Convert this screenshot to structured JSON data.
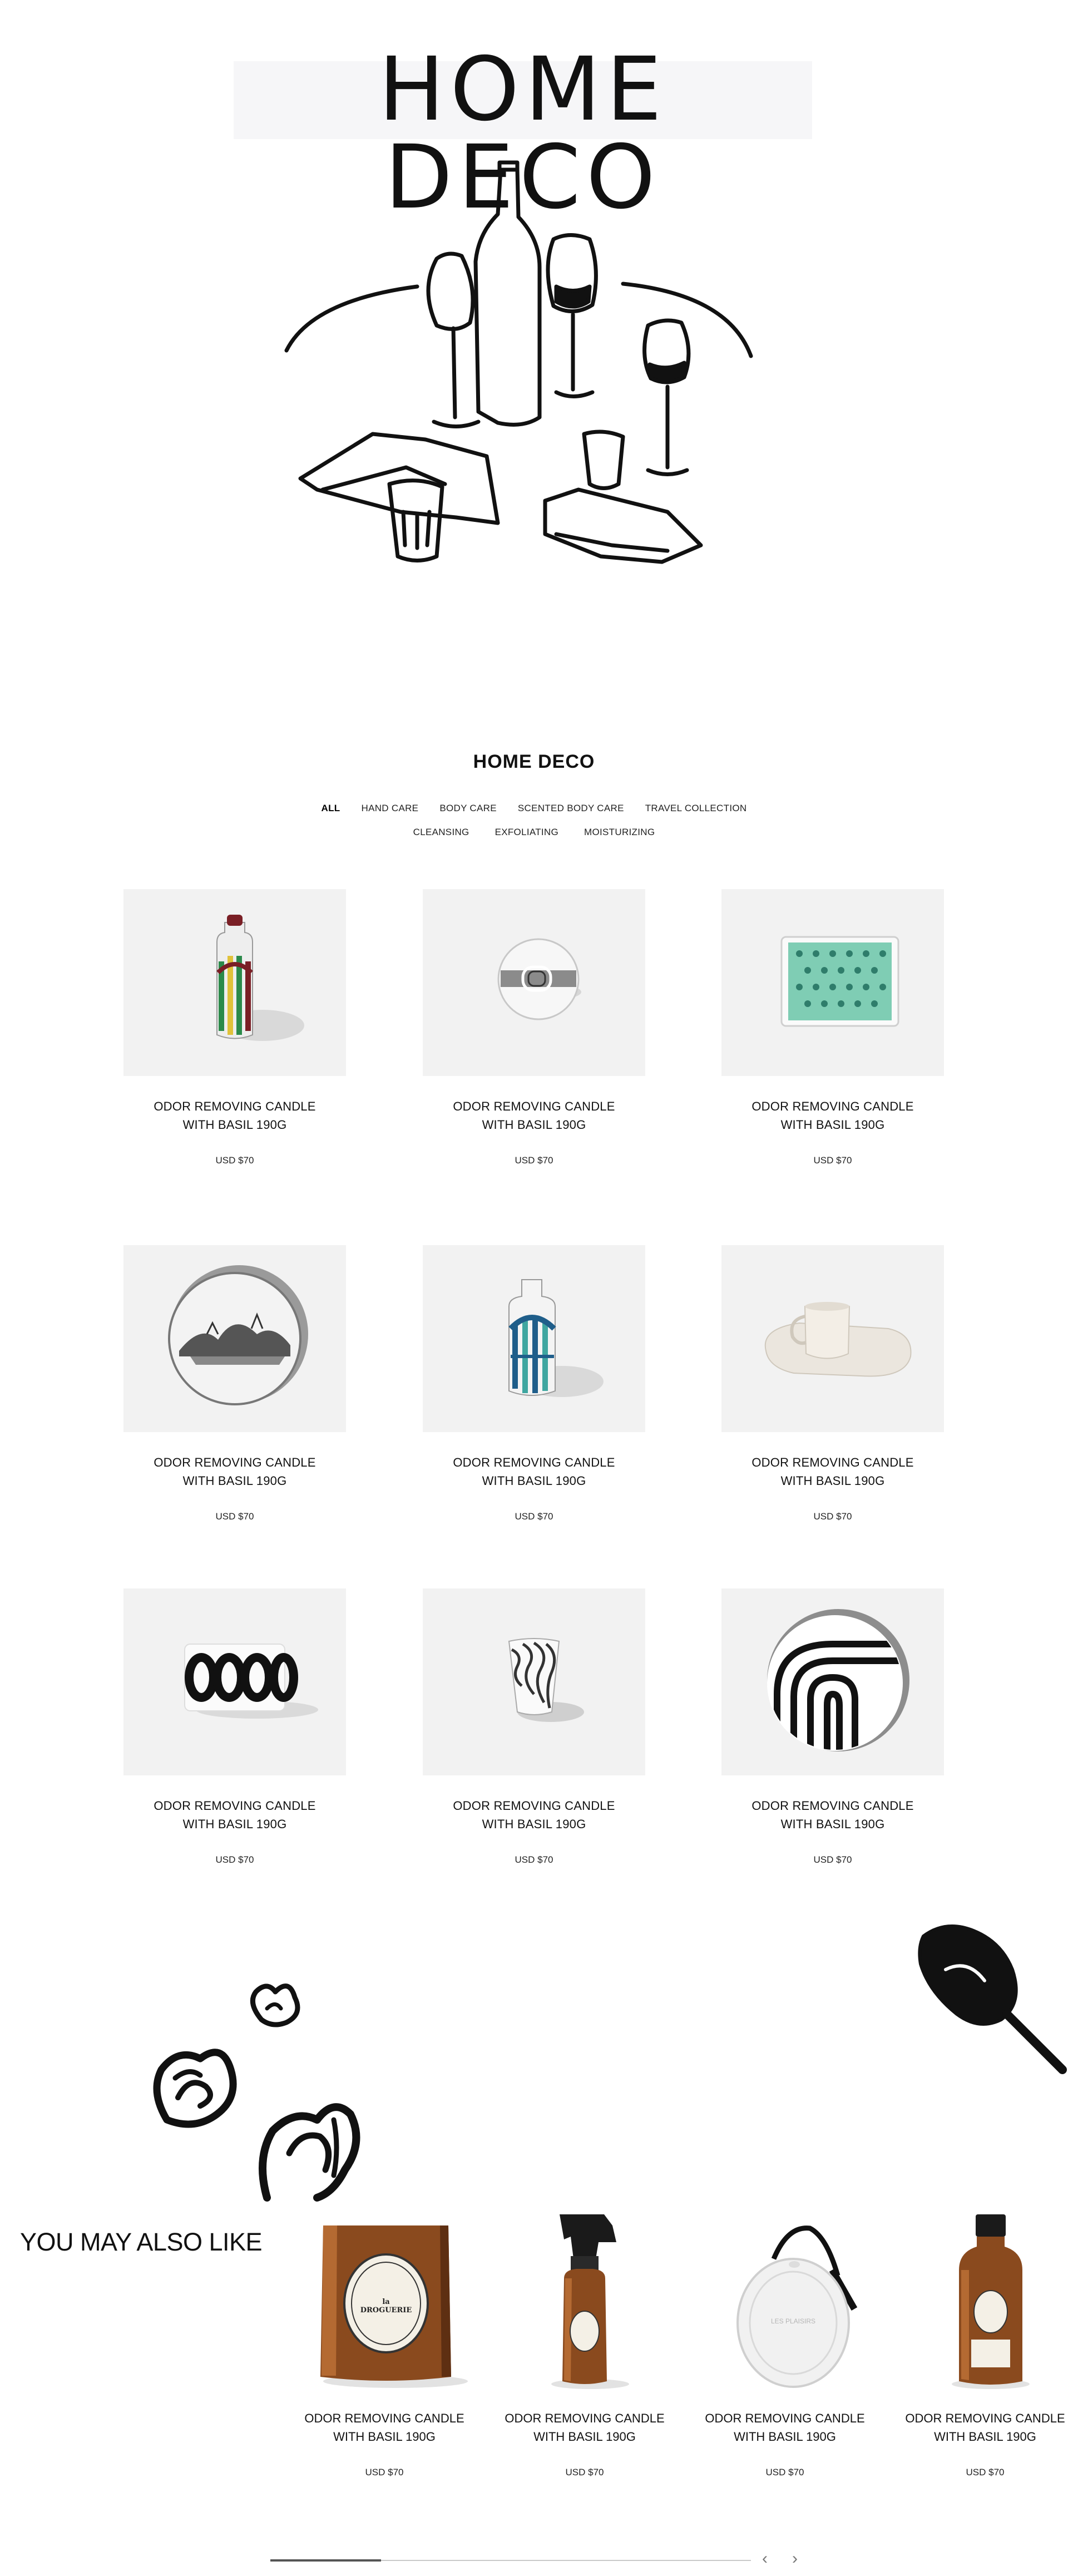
{
  "hero": {
    "title": "HOME DECO"
  },
  "section": {
    "title": "HOME DECO",
    "filters_row1": [
      "ALL",
      "HAND CARE",
      "BODY CARE",
      "SCENTED BODY CARE",
      "TRAVEL COLLECTION"
    ],
    "filters_row2": [
      "CLEANSING",
      "EXFOLIATING",
      "MOISTURIZING"
    ],
    "active_filter": "ALL"
  },
  "products": [
    {
      "name": "ODOR REMOVING CANDLE WITH BASIL 190G",
      "price": "USD $70",
      "image": "striped-vase"
    },
    {
      "name": "ODOR REMOVING CANDLE WITH BASIL 190G",
      "price": "USD $70",
      "image": "round-dish"
    },
    {
      "name": "ODOR REMOVING CANDLE WITH BASIL 190G",
      "price": "USD $70",
      "image": "green-tray"
    },
    {
      "name": "ODOR REMOVING CANDLE WITH BASIL 190G",
      "price": "USD $70",
      "image": "landscape-plate"
    },
    {
      "name": "ODOR REMOVING CANDLE WITH BASIL 190G",
      "price": "USD $70",
      "image": "blue-vase"
    },
    {
      "name": "ODOR REMOVING CANDLE WITH BASIL 190G",
      "price": "USD $70",
      "image": "cup-and-saucer"
    },
    {
      "name": "ODOR REMOVING CANDLE WITH BASIL 190G",
      "price": "USD $70",
      "image": "ring-candle"
    },
    {
      "name": "ODOR REMOVING CANDLE WITH BASIL 190G",
      "price": "USD $70",
      "image": "wave-tumbler"
    },
    {
      "name": "ODOR REMOVING CANDLE WITH BASIL 190G",
      "price": "USD $70",
      "image": "arch-plate"
    }
  ],
  "recommendations": {
    "title": "YOU MAY ALSO LIKE",
    "items": [
      {
        "name": "ODOR REMOVING CANDLE WITH BASIL 190G",
        "price": "USD $70",
        "image": "amber-candle",
        "label_text": "la DROGUERIE"
      },
      {
        "name": "ODOR REMOVING CANDLE WITH BASIL 190G",
        "price": "USD $70",
        "image": "spray-bottle"
      },
      {
        "name": "ODOR REMOVING CANDLE WITH BASIL 190G",
        "price": "USD $70",
        "image": "scented-oval",
        "label_text": "LES PLAISIRS"
      },
      {
        "name": "ODOR REMOVING CANDLE WITH BASIL 190G",
        "price": "USD $70",
        "image": "amber-bottle"
      }
    ],
    "scroll_progress": 0.23
  },
  "icons": {
    "prev": "chevron-left-icon",
    "next": "chevron-right-icon"
  },
  "colors": {
    "background": "#ffffff",
    "thumb_bg": "#f2f2f2",
    "text": "#111111",
    "amber": "#8a4a1e",
    "teal": "#3fa6a0"
  }
}
